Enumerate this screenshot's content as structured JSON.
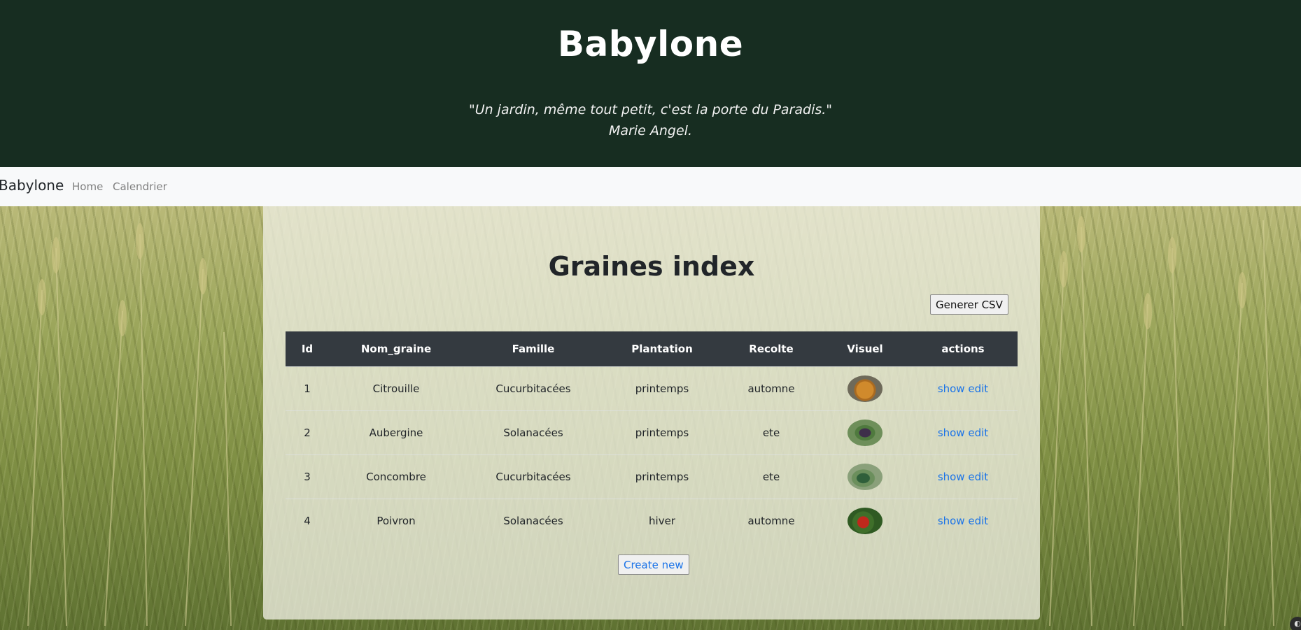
{
  "header": {
    "title": "Babylone",
    "quote_line1": "\"Un jardin, même tout petit, c'est la porte du Paradis.\"",
    "quote_line2": "Marie Angel."
  },
  "navbar": {
    "brand": "Babylone",
    "links": [
      "Home",
      "Calendrier"
    ]
  },
  "main": {
    "title": "Graines index",
    "csv_button": "Generer CSV",
    "create_button": "Create new",
    "columns": [
      "Id",
      "Nom_graine",
      "Famille",
      "Plantation",
      "Recolte",
      "Visuel",
      "actions"
    ],
    "rows": [
      {
        "id": "1",
        "nom": "Citrouille",
        "famille": "Cucurbitacées",
        "plantation": "printemps",
        "recolte": "automne",
        "visuel_icon": "pumpkin-thumbnail",
        "show": "show",
        "edit": "edit"
      },
      {
        "id": "2",
        "nom": "Aubergine",
        "famille": "Solanacées",
        "plantation": "printemps",
        "recolte": "ete",
        "visuel_icon": "eggplant-thumbnail",
        "show": "show",
        "edit": "edit"
      },
      {
        "id": "3",
        "nom": "Concombre",
        "famille": "Cucurbitacées",
        "plantation": "printemps",
        "recolte": "ete",
        "visuel_icon": "cucumber-thumbnail",
        "show": "show",
        "edit": "edit"
      },
      {
        "id": "4",
        "nom": "Poivron",
        "famille": "Solanacées",
        "plantation": "hiver",
        "recolte": "automne",
        "visuel_icon": "pepper-thumbnail",
        "show": "show",
        "edit": "edit"
      }
    ]
  },
  "colors": {
    "header_bg": "#172d21",
    "navbar_bg": "#f8f9fa",
    "table_header_bg": "#343a40",
    "link": "#1a73e8"
  }
}
